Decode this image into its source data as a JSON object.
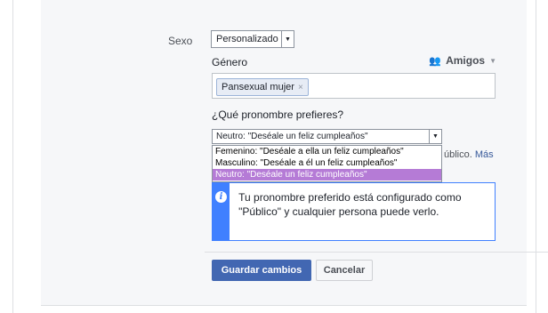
{
  "sex": {
    "label": "Sexo",
    "selected": "Personalizado"
  },
  "gender": {
    "label": "Género",
    "audience_label": "Amigos",
    "audience_icon": "friends-icon",
    "token": "Pansexual mujer",
    "token_remove": "×"
  },
  "pronoun": {
    "question": "¿Qué pronombre prefieres?",
    "selected": "Neutro: \"Deséale un feliz cumpleaños\"",
    "options": [
      "Femenino: \"Deséale a ella un feliz cumpleaños\"",
      "Masculino: \"Deséale a él un feliz cumpleaños\"",
      "Neutro: \"Deséale un feliz cumpleaños\""
    ],
    "behind_text": "úblico.",
    "behind_link": "Más"
  },
  "info": {
    "icon": "info-icon",
    "message": "Tu pronombre preferido está configurado como \"Público\" y cualquier persona puede verlo."
  },
  "buttons": {
    "save": "Guardar cambios",
    "cancel": "Cancelar"
  },
  "colors": {
    "accent": "#4267b2",
    "info_blue": "#4080ff",
    "highlight": "#b57bd6"
  }
}
